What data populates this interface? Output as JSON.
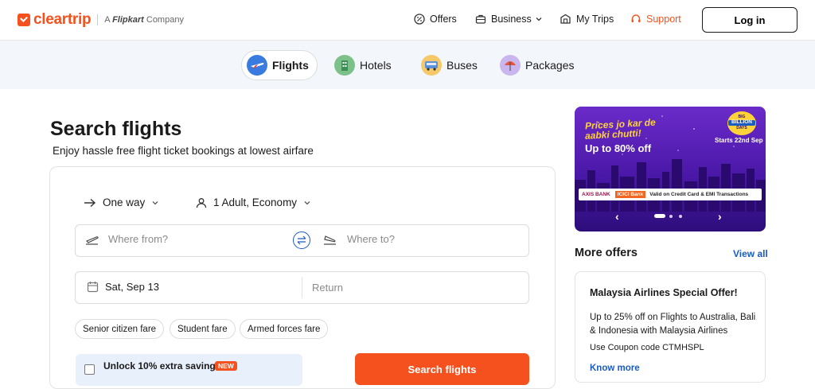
{
  "header": {
    "logo_text": "cleartrip",
    "logo_sub_prefix": "A",
    "logo_sub_brand": "Flipkart",
    "logo_sub_suffix": "Company",
    "nav": {
      "offers": "Offers",
      "business": "Business",
      "my_trips": "My Trips",
      "support": "Support"
    },
    "login": "Log in"
  },
  "tabs": [
    {
      "label": "Flights",
      "icon": "plane-icon"
    },
    {
      "label": "Hotels",
      "icon": "hotel-icon"
    },
    {
      "label": "Buses",
      "icon": "bus-icon"
    },
    {
      "label": "Packages",
      "icon": "umbrella-icon"
    }
  ],
  "search": {
    "title": "Search flights",
    "subtitle": "Enjoy hassle free flight ticket bookings at lowest airfare",
    "trip_type": "One way",
    "travellers": "1 Adult, Economy",
    "from_placeholder": "Where from?",
    "to_placeholder": "Where to?",
    "depart_date": "Sat, Sep 13",
    "return_placeholder": "Return",
    "fare_chips": [
      "Senior citizen fare",
      "Student fare",
      "Armed forces fare"
    ],
    "unlock_text": "Unlock 10% extra savings",
    "new_badge": "NEW",
    "search_button": "Search flights"
  },
  "banner": {
    "line1": "Prices jo kar de",
    "line2": "aabki chutti!",
    "discount": "Up to 80% off",
    "starts": "Starts 22nd Sep",
    "seal_top": "BIG",
    "seal_main": "BILLION",
    "seal_bottom": "DAYS",
    "bank1": "AXIS BANK",
    "bank2": "ICICI Bank",
    "bank_terms": "Valid on Credit Card & EMI Transactions",
    "slide_index": 1,
    "slide_count": 3
  },
  "offers": {
    "heading": "More offers",
    "view_all": "View all",
    "card": {
      "title": "Malaysia Airlines Special Offer!",
      "body": "Up to 25% off on Flights to Australia, Bali & Indonesia with Malaysia Airlines",
      "coupon": "Use Coupon code CTMHSPL",
      "link": "Know more"
    }
  },
  "colors": {
    "brand": "#f4511e",
    "link": "#1a5bc4",
    "tab_bar_bg": "#f3f6fa",
    "unlock_bg": "#e8f0fc"
  }
}
